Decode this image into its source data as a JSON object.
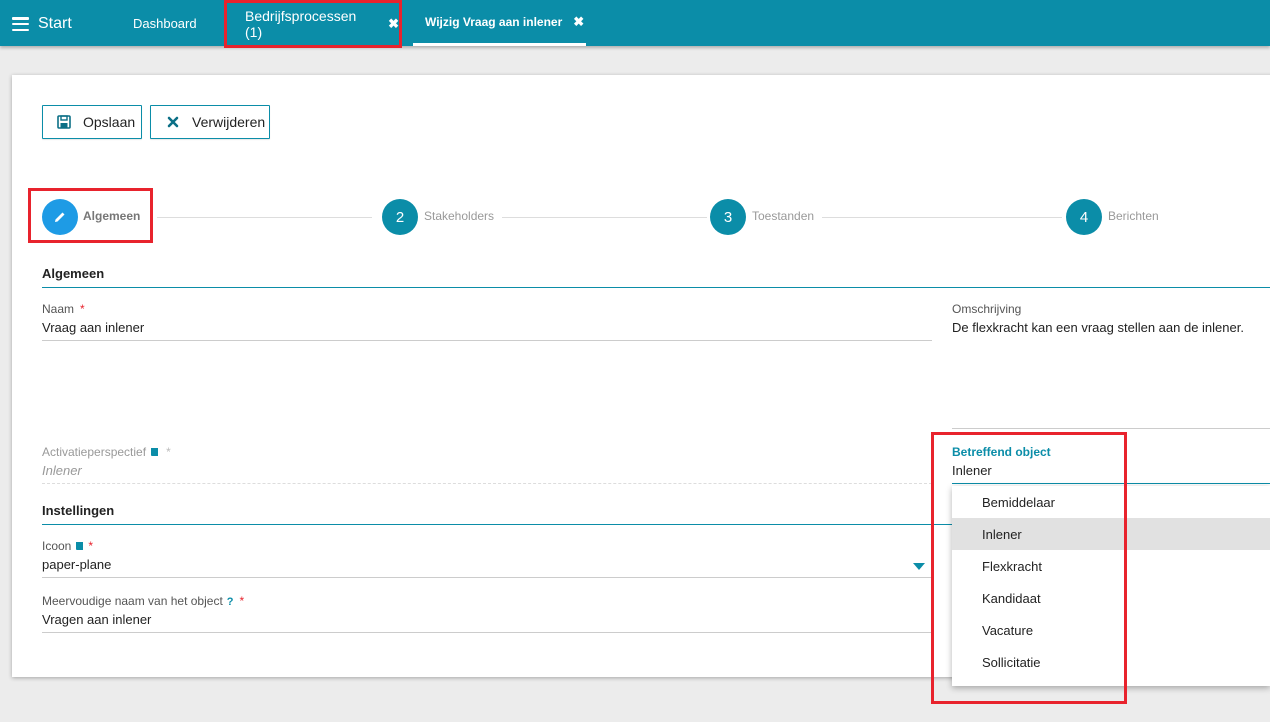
{
  "topbar": {
    "start_label": "Start",
    "tabs": [
      {
        "label": "Dashboard"
      },
      {
        "label": "Bedrijfsprocessen (1)"
      },
      {
        "label": "Wijzig Vraag aan inlener"
      }
    ]
  },
  "toolbar": {
    "save_label": "Opslaan",
    "delete_label": "Verwijderen"
  },
  "stepper": {
    "steps": [
      {
        "number": "",
        "label": "Algemeen"
      },
      {
        "number": "2",
        "label": "Stakeholders"
      },
      {
        "number": "3",
        "label": "Toestanden"
      },
      {
        "number": "4",
        "label": "Berichten"
      }
    ]
  },
  "general": {
    "section_title": "Algemeen",
    "naam_label": "Naam",
    "naam_value": "Vraag aan inlener",
    "omschrijving_label": "Omschrijving",
    "omschrijving_value": "De flexkracht kan een vraag stellen aan de inlener.",
    "activatie_label": "Activatieperspectief",
    "activatie_value": "Inlener",
    "betreffend_label": "Betreffend object",
    "betreffend_value": "Inlener"
  },
  "settings": {
    "section_title": "Instellingen",
    "icoon_label": "Icoon",
    "icoon_value": "paper-plane",
    "meervoud_label": "Meervoudige naam van het object",
    "meervoud_value": "Vragen aan inlener"
  },
  "required_marker": "*",
  "help_marker": "?",
  "dropdown": {
    "options": [
      "Bemiddelaar",
      "Inlener",
      "Flexkracht",
      "Kandidaat",
      "Vacature",
      "Sollicitatie"
    ],
    "selected": "Inlener"
  },
  "colors": {
    "primary": "#0b8da8",
    "active_step": "#1e9be5",
    "highlight": "#e8232d"
  }
}
